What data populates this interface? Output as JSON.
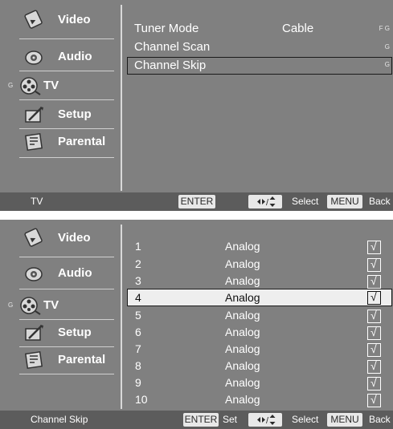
{
  "sidebar": {
    "items": [
      {
        "label": "Video",
        "icon": "video-icon"
      },
      {
        "label": "Audio",
        "icon": "audio-icon"
      },
      {
        "label": "TV",
        "icon": "tv-icon",
        "flag": "G"
      },
      {
        "label": "Setup",
        "icon": "setup-icon"
      },
      {
        "label": "Parental",
        "icon": "parental-icon"
      }
    ]
  },
  "screen1": {
    "rows": [
      {
        "label": "Tuner Mode",
        "value": "Cable",
        "flag": "F G"
      },
      {
        "label": "Channel Scan",
        "value": "",
        "flag": "G"
      },
      {
        "label": "Channel Skip",
        "value": "",
        "flag": "G"
      }
    ],
    "selected_index": 2,
    "footer": {
      "location": "TV",
      "enter_key": "ENTER",
      "select_label": "Select",
      "menu_key": "MENU",
      "back_label": "Back"
    }
  },
  "screen2": {
    "channels": [
      {
        "num": "1",
        "type": "Analog",
        "check": "√"
      },
      {
        "num": "2",
        "type": "Analog",
        "check": "√"
      },
      {
        "num": "3",
        "type": "Analog",
        "check": "√"
      },
      {
        "num": "4",
        "type": "Analog",
        "check": "√"
      },
      {
        "num": "5",
        "type": "Analog",
        "check": "√"
      },
      {
        "num": "6",
        "type": "Analog",
        "check": "√"
      },
      {
        "num": "7",
        "type": "Analog",
        "check": "√"
      },
      {
        "num": "8",
        "type": "Analog",
        "check": "√"
      },
      {
        "num": "9",
        "type": "Analog",
        "check": "√"
      },
      {
        "num": "10",
        "type": "Analog",
        "check": "√"
      }
    ],
    "selected_index": 3,
    "footer": {
      "location": "Channel Skip",
      "enter_key": "ENTER",
      "set_label": "Set",
      "select_label": "Select",
      "menu_key": "MENU",
      "back_label": "Back"
    }
  },
  "colors": {
    "panel": "#808080",
    "footer": "#5c5c5c",
    "text": "#ffffff",
    "highlight_border": "#1a1a1a"
  }
}
